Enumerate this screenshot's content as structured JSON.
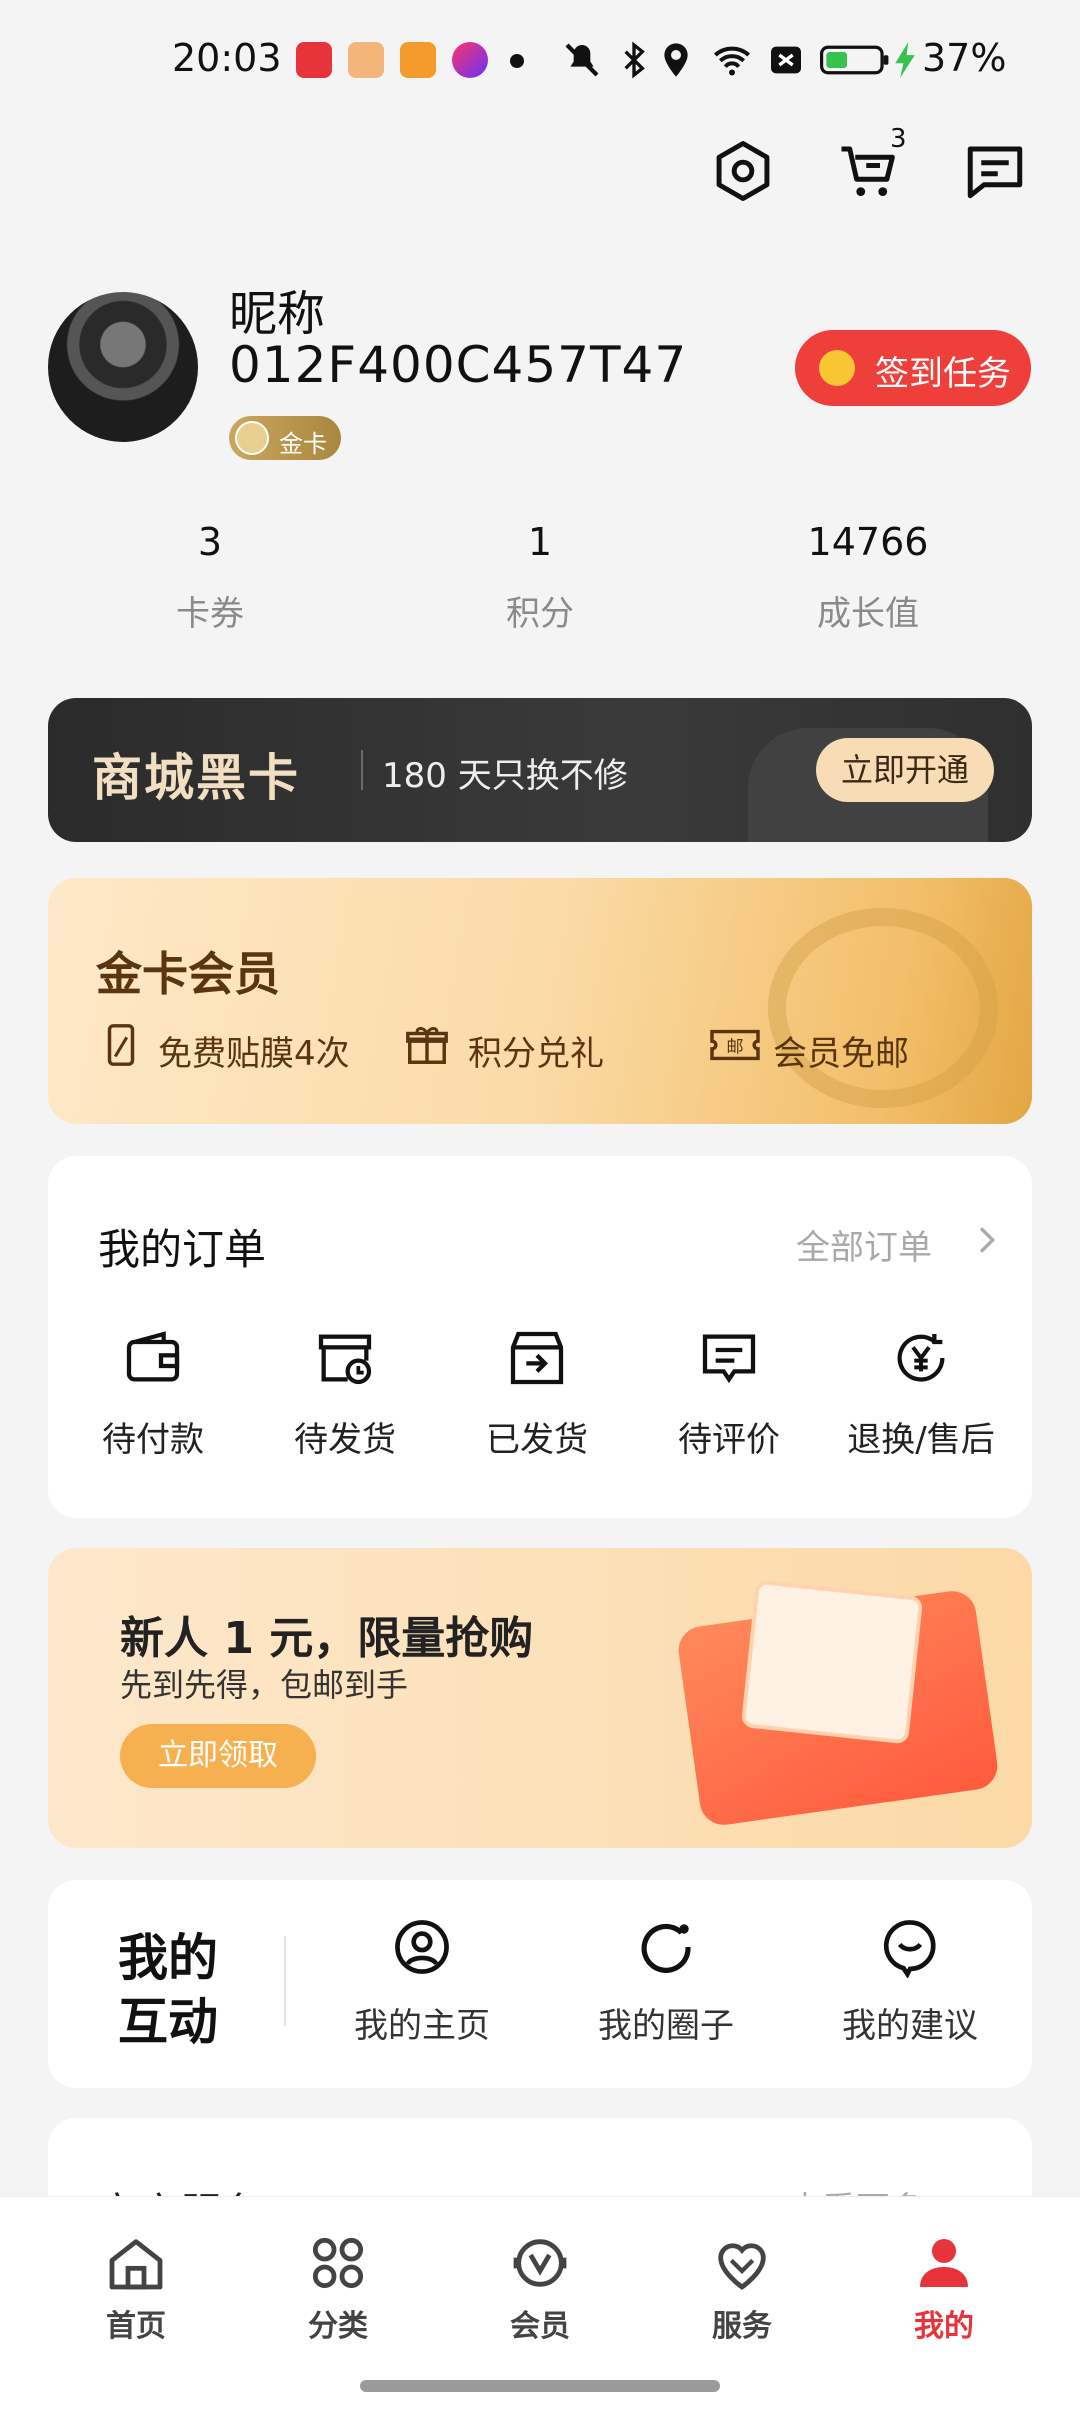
{
  "status_bar": {
    "time": "20:03",
    "battery": "37%"
  },
  "header": {
    "settings_icon": "hexagon-settings-icon",
    "cart_icon": "cart-icon",
    "cart_count": "3",
    "message_icon": "message-icon"
  },
  "profile": {
    "nickname": "昵称",
    "user_id": "012F400C457T47",
    "tier_badge": "金卡",
    "signin_label": "签到任务"
  },
  "stats": [
    {
      "value": "3",
      "label": "卡券"
    },
    {
      "value": "1",
      "label": "积分"
    },
    {
      "value": "14766",
      "label": "成长值"
    }
  ],
  "black_card": {
    "title": "商城黑卡",
    "subtitle": "180 天只换不修",
    "button": "立即开通"
  },
  "gold_member": {
    "title": "金卡会员",
    "features": [
      {
        "icon": "phone-film-icon",
        "label": "免费贴膜4次"
      },
      {
        "icon": "gift-icon",
        "label": "积分兑礼"
      },
      {
        "icon": "mail-ticket-icon",
        "label": "会员免邮"
      }
    ]
  },
  "orders": {
    "title": "我的订单",
    "all_label": "全部订单",
    "items": [
      {
        "icon": "wallet-icon",
        "label": "待付款"
      },
      {
        "icon": "box-clock-icon",
        "label": "待发货"
      },
      {
        "icon": "box-arrow-icon",
        "label": "已发货"
      },
      {
        "icon": "comment-icon",
        "label": "待评价"
      },
      {
        "icon": "refund-icon",
        "label": "退换/售后"
      }
    ]
  },
  "promo": {
    "title": "新人 1 元，限量抢购",
    "subtitle": "先到先得，包邮到手",
    "button": "立即领取"
  },
  "interactions": {
    "title": "我的互动",
    "items": [
      {
        "icon": "user-circle-icon",
        "label": "我的主页"
      },
      {
        "icon": "circle-icon",
        "label": "我的圈子"
      },
      {
        "icon": "suggestion-icon",
        "label": "我的建议"
      }
    ]
  },
  "official_services": {
    "title": "官方服务",
    "more": "查看更多"
  },
  "bottom_nav": [
    {
      "icon": "home-icon",
      "label": "首页",
      "active": false
    },
    {
      "icon": "category-icon",
      "label": "分类",
      "active": false
    },
    {
      "icon": "member-icon",
      "label": "会员",
      "active": false
    },
    {
      "icon": "heart-icon",
      "label": "服务",
      "active": false
    },
    {
      "icon": "user-icon",
      "label": "我的",
      "active": true
    }
  ],
  "colors": {
    "accent_red": "#e8333a",
    "gold": "#c9a75e",
    "background": "#f4f4f4"
  }
}
